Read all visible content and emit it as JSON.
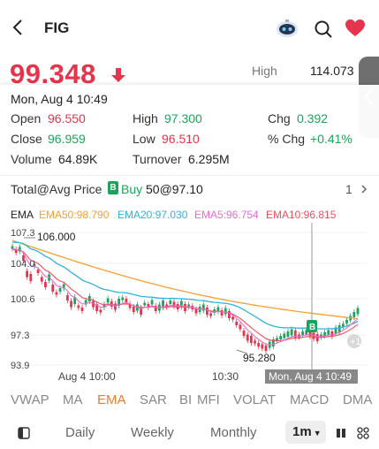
{
  "header": {
    "ticker": "FIG"
  },
  "quote": {
    "price": "99.348",
    "high_label": "High",
    "high_value": "114.073"
  },
  "popup": {
    "datetime": "Mon, Aug 4 10:49",
    "open_label": "Open",
    "open_value": "96.550",
    "high_label": "High",
    "high_value": "97.300",
    "chg_label": "Chg",
    "chg_value": "0.392",
    "close_label": "Close",
    "close_value": "96.959",
    "low_label": "Low",
    "low_value": "96.510",
    "pchg_label": "% Chg",
    "pchg_value": "+0.41%",
    "volume_label": "Volume",
    "volume_value": "64.89K",
    "turnover_label": "Turnover",
    "turnover_value": "6.295M"
  },
  "position": {
    "label": "Total@Avg Price",
    "badge": "B",
    "side": "Buy",
    "detail": "50@97.10",
    "count": "1"
  },
  "ema": {
    "title": "EMA",
    "ema50": "EMA50:98.790",
    "ema20": "EMA20:97.030",
    "ema5": "EMA5:96.754",
    "ema10": "EMA10:96.815"
  },
  "colors": {
    "up": "#1aa55c",
    "down": "#e5344b",
    "ema50": "#f5a033",
    "ema20": "#33b0de",
    "ema5": "#e86bd8",
    "ema10": "#ee4e5a"
  },
  "chart_data": {
    "type": "candlestick",
    "y_ticks": [
      "107.3",
      "104.0",
      "100.6",
      "97.3",
      "93.9"
    ],
    "x_ticks": [
      "Aug 4 10:00",
      "10:30"
    ],
    "crosshair_label": "Mon, Aug 4 10:49",
    "annotations": [
      "106.000",
      "95.280"
    ],
    "ylim": [
      93.9,
      107.3
    ]
  },
  "indicator_tabs": [
    "VWAP",
    "MA",
    "EMA",
    "SAR",
    "BI",
    "MFI",
    "VOLAT",
    "MACD",
    "DMA"
  ],
  "active_indicator": "EMA",
  "periods": {
    "daily": "Daily",
    "weekly": "Weekly",
    "monthly": "Monthly",
    "active": "1m"
  }
}
